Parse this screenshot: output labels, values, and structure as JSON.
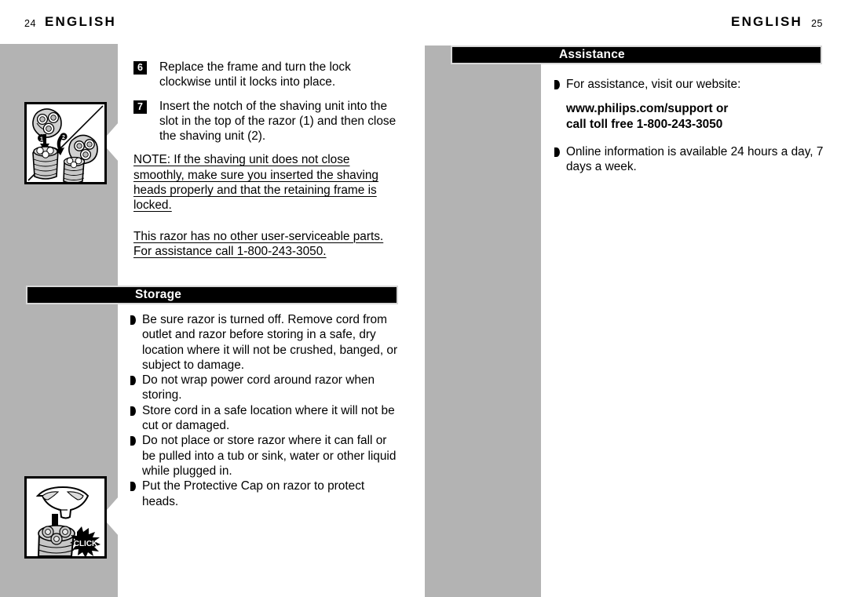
{
  "document": {
    "left_page": {
      "running_head": "ENGLISH",
      "folio": "24",
      "steps": [
        {
          "number": "6",
          "text": "Replace the frame and turn the lock clockwise until it locks into place."
        },
        {
          "number": "7",
          "text": "Insert the notch of the shaving unit into the slot in the top of the razor (1) and then close the shaving unit (2)."
        }
      ],
      "notes": [
        "NOTE: If the shaving unit does not close smoothly, make sure you inserted the shaving heads properly and that the retaining frame is locked.",
        "This razor has no other user-serviceable parts. For assistance call 1-800-243-3050."
      ],
      "section": {
        "title": "Storage",
        "bullets": [
          "Be sure razor is turned off. Remove cord from outlet and razor before storing in a safe, dry location where it will not be crushed, banged, or subject to damage.",
          "Do not wrap power cord around razor when storing.",
          "Store cord in a safe location where it will not be cut or damaged.",
          "Do not place or store razor where it can fall or be pulled into a tub or sink, water or other liquid while plugged in.",
          "Put the Protective Cap on razor to protect heads."
        ]
      },
      "figures": [
        {
          "name": "shaving-unit-insert-figure",
          "callouts": [
            "1",
            "2"
          ]
        },
        {
          "name": "protective-cap-click-figure",
          "label": "CLICK"
        }
      ]
    },
    "right_page": {
      "running_head": "ENGLISH",
      "folio": "25",
      "section": {
        "title": "Assistance",
        "bullets_before": [
          "For assistance, visit our website:"
        ],
        "contact_lines": [
          "www.philips.com/support or",
          "call toll free 1-800-243-3050"
        ],
        "bullets_after": [
          "Online information is available 24 hours a day, 7 days a week."
        ]
      }
    }
  },
  "colors": {
    "page_background": "#ffffff",
    "side_band_grey": "#b3b3b3",
    "bar_black": "#000000",
    "bar_border_grey": "#d8d8d8",
    "text_black": "#000000",
    "bar_text_white": "#ffffff"
  }
}
